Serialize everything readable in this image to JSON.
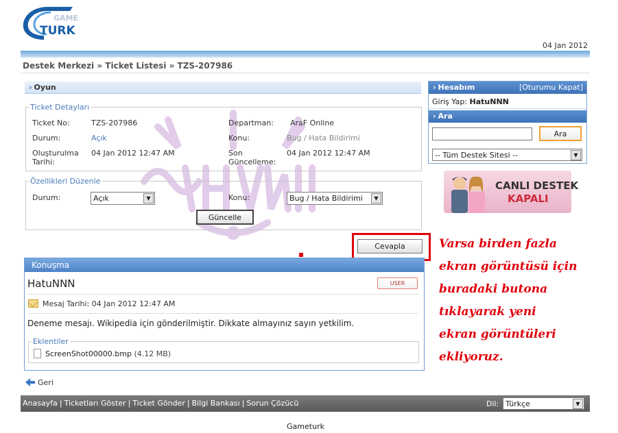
{
  "header": {
    "logo_top": "GAME",
    "logo_bottom": "TURK",
    "date": "04 Jan 2012",
    "breadcrumb": "Destek Merkezi » Ticket Listesi » TZS-207986"
  },
  "section": {
    "title": "Oyun"
  },
  "ticket": {
    "legend": "Ticket Detayları",
    "no_label": "Ticket No:",
    "no_value": "TZS-207986",
    "status_label": "Durum:",
    "status_value": "Açık",
    "created_label": "Oluşturulma Tarihi:",
    "created_value": "04 Jan 2012 12:47 AM",
    "dept_label": "Departman:",
    "dept_value": "AraF Online",
    "topic_label": "Konu:",
    "topic_value": "Bug / Hata Bildirimi",
    "updated_label": "Son Güncelleme:",
    "updated_value": "04 Jan 2012 12:47 AM"
  },
  "edit": {
    "legend": "Özellikleri Düzenle",
    "status_label": "Durum:",
    "status_selected": "Açık",
    "topic_label": "Konu:",
    "topic_selected": "Bug / Hata Bildirimi",
    "update_button": "Güncelle"
  },
  "reply_button": "Cevapla",
  "conversation": {
    "title": "Konuşma",
    "user": "HatuNNN",
    "badge": "USER",
    "date_label": "Mesaj Tarihi: 04 Jan 2012 12:47 AM",
    "message": "Deneme mesajı. Wikipedia için gönderilmiştir. Dikkate almayınız sayın yetkilim.",
    "attachments_legend": "Eklentiler",
    "file_name": "ScreenShot00000.bmp",
    "file_size": "(4.12 MB)"
  },
  "back": "Geri",
  "sidebar": {
    "account_title": "Hesabım",
    "logout": "[Oturumu Kapat]",
    "login_label": "Giriş Yap:",
    "login_user": "HatuNNN",
    "search_title": "Ara",
    "search_value": "",
    "search_button": "Ara",
    "site_select": "-- Tüm Destek Sitesi --",
    "live_1": "CANLI DESTEK",
    "live_2": "KAPALI"
  },
  "annotation": [
    "Varsa birden fazla",
    "ekran görüntüsü için",
    "buradaki butona",
    "tıklayarak yeni",
    "ekran görüntüleri",
    "ekliyoruz."
  ],
  "footer": {
    "links": [
      "Anasayfa",
      "Ticketları Göster",
      "Ticket Gönder",
      "Bilgi Bankası",
      "Sorun Çözücü"
    ],
    "lang_label": "Dil:",
    "lang_selected": "Türkçe",
    "copyright": "Gameturk"
  },
  "colors": {
    "accent": "#4a79b8",
    "annotation": "#e0000b",
    "footer": "#6a6a6a"
  }
}
